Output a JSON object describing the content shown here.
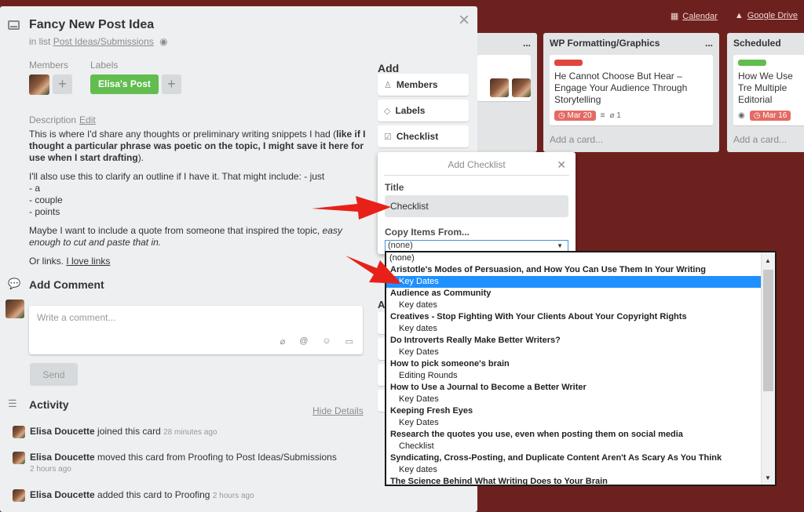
{
  "board": {
    "links": [
      {
        "icon": "calendar-icon",
        "label": "Calendar"
      },
      {
        "icon": "google-drive-icon",
        "label": "Google Drive"
      }
    ],
    "lists": [
      {
        "title": "WP Formatting/Graphics",
        "menu": "...",
        "card": {
          "label_color": "#e0463c",
          "text": "He Cannot Choose But Hear – Engage Your Audience Through Storytelling",
          "due": "Mar 20",
          "attachments": "1"
        },
        "add_card": "Add a card..."
      },
      {
        "title": "Scheduled",
        "menu": "...",
        "card": {
          "label_color": "#61bd4f",
          "text": "How We Use Tre Multiple Editorial",
          "due": "Mar 16"
        },
        "add_card": "Add a card..."
      }
    ],
    "left_list": {
      "menu": "..."
    }
  },
  "card": {
    "title": "Fancy New Post Idea",
    "in_list_prefix": "in list",
    "list_name": "Post Ideas/Submissions",
    "members_label": "Members",
    "labels_label": "Labels",
    "label_chip": "Elisa's Post",
    "plus": "+",
    "description_label": "Description",
    "edit": "Edit",
    "desc_p1_a": "This is where I'd share any thoughts or preliminary writing snippets I had (",
    "desc_p1_b": "like if I thought a particular phrase was poetic on the topic, I might save it here for use when I start drafting",
    "desc_p1_c": ").",
    "desc_p2_a": "I'll also use this to clarify an outline if I have it. That might include: - just",
    "desc_p2_b": "- a",
    "desc_p2_c": "- couple",
    "desc_p2_d": "- points",
    "desc_p3_a": "Maybe I want to include a quote from someone that inspired the topic, ",
    "desc_p3_b": "easy enough to cut and paste that in.",
    "desc_p4_a": "Or links. ",
    "desc_p4_b": "I love links",
    "add_comment_head": "Add Comment",
    "comment_placeholder": "Write a comment...",
    "send": "Send",
    "activity_head": "Activity",
    "hide_details": "Hide Details",
    "activity": [
      {
        "who": "Elisa Doucette",
        "what": "joined this card",
        "when": "28 minutes ago",
        "sub": ""
      },
      {
        "who": "Elisa Doucette",
        "what": "moved this card from Proofing to Post Ideas/Submissions",
        "when": "",
        "sub": "2 hours ago"
      },
      {
        "who": "Elisa Doucette",
        "what": "added this card to Proofing",
        "when": "2 hours ago",
        "sub": ""
      }
    ]
  },
  "sidebar": {
    "add_head": "Add",
    "buttons": [
      {
        "icon": "person-icon",
        "label": "Members"
      },
      {
        "icon": "tag-icon",
        "label": "Labels"
      },
      {
        "icon": "checkbox-icon",
        "label": "Checklist"
      }
    ],
    "partial_letter": "A"
  },
  "popover": {
    "title": "Add Checklist",
    "title_label": "Title",
    "title_value": "Checklist",
    "copy_label": "Copy Items From...",
    "select_value": "(none)"
  },
  "dropdown": {
    "options": [
      {
        "text": "(none)",
        "kind": "plain"
      },
      {
        "text": "Aristotle's Modes of Persuasion, and How You Can Use Them In Your Writing",
        "kind": "group"
      },
      {
        "text": "Key Dates",
        "kind": "child",
        "selected": true
      },
      {
        "text": "Audience as Community",
        "kind": "group"
      },
      {
        "text": "Key dates",
        "kind": "child"
      },
      {
        "text": "Creatives - Stop Fighting With Your Clients About Your Copyright Rights",
        "kind": "group"
      },
      {
        "text": "Key dates",
        "kind": "child"
      },
      {
        "text": "Do Introverts Really Make Better Writers?",
        "kind": "group"
      },
      {
        "text": "Key Dates",
        "kind": "child"
      },
      {
        "text": "How to pick someone's brain",
        "kind": "group"
      },
      {
        "text": "Editing Rounds",
        "kind": "child"
      },
      {
        "text": "How to Use a Journal to Become a Better Writer",
        "kind": "group"
      },
      {
        "text": "Key Dates",
        "kind": "child"
      },
      {
        "text": "Keeping Fresh Eyes",
        "kind": "group"
      },
      {
        "text": "Key Dates",
        "kind": "child"
      },
      {
        "text": "Research the quotes you use, even when posting them on social media",
        "kind": "group"
      },
      {
        "text": "Checklist",
        "kind": "child"
      },
      {
        "text": "Syndicating, Cross-Posting, and Duplicate Content Aren't As Scary As You Think",
        "kind": "group"
      },
      {
        "text": "Key dates",
        "kind": "child"
      },
      {
        "text": "The Science Behind What Writing Does to Your Brain",
        "kind": "group"
      }
    ]
  },
  "colors": {
    "board_bg": "#6d211e",
    "label_green": "#61bd4f",
    "selected_option": "#1e90ff",
    "annotation_arrow": "#e8201a"
  }
}
